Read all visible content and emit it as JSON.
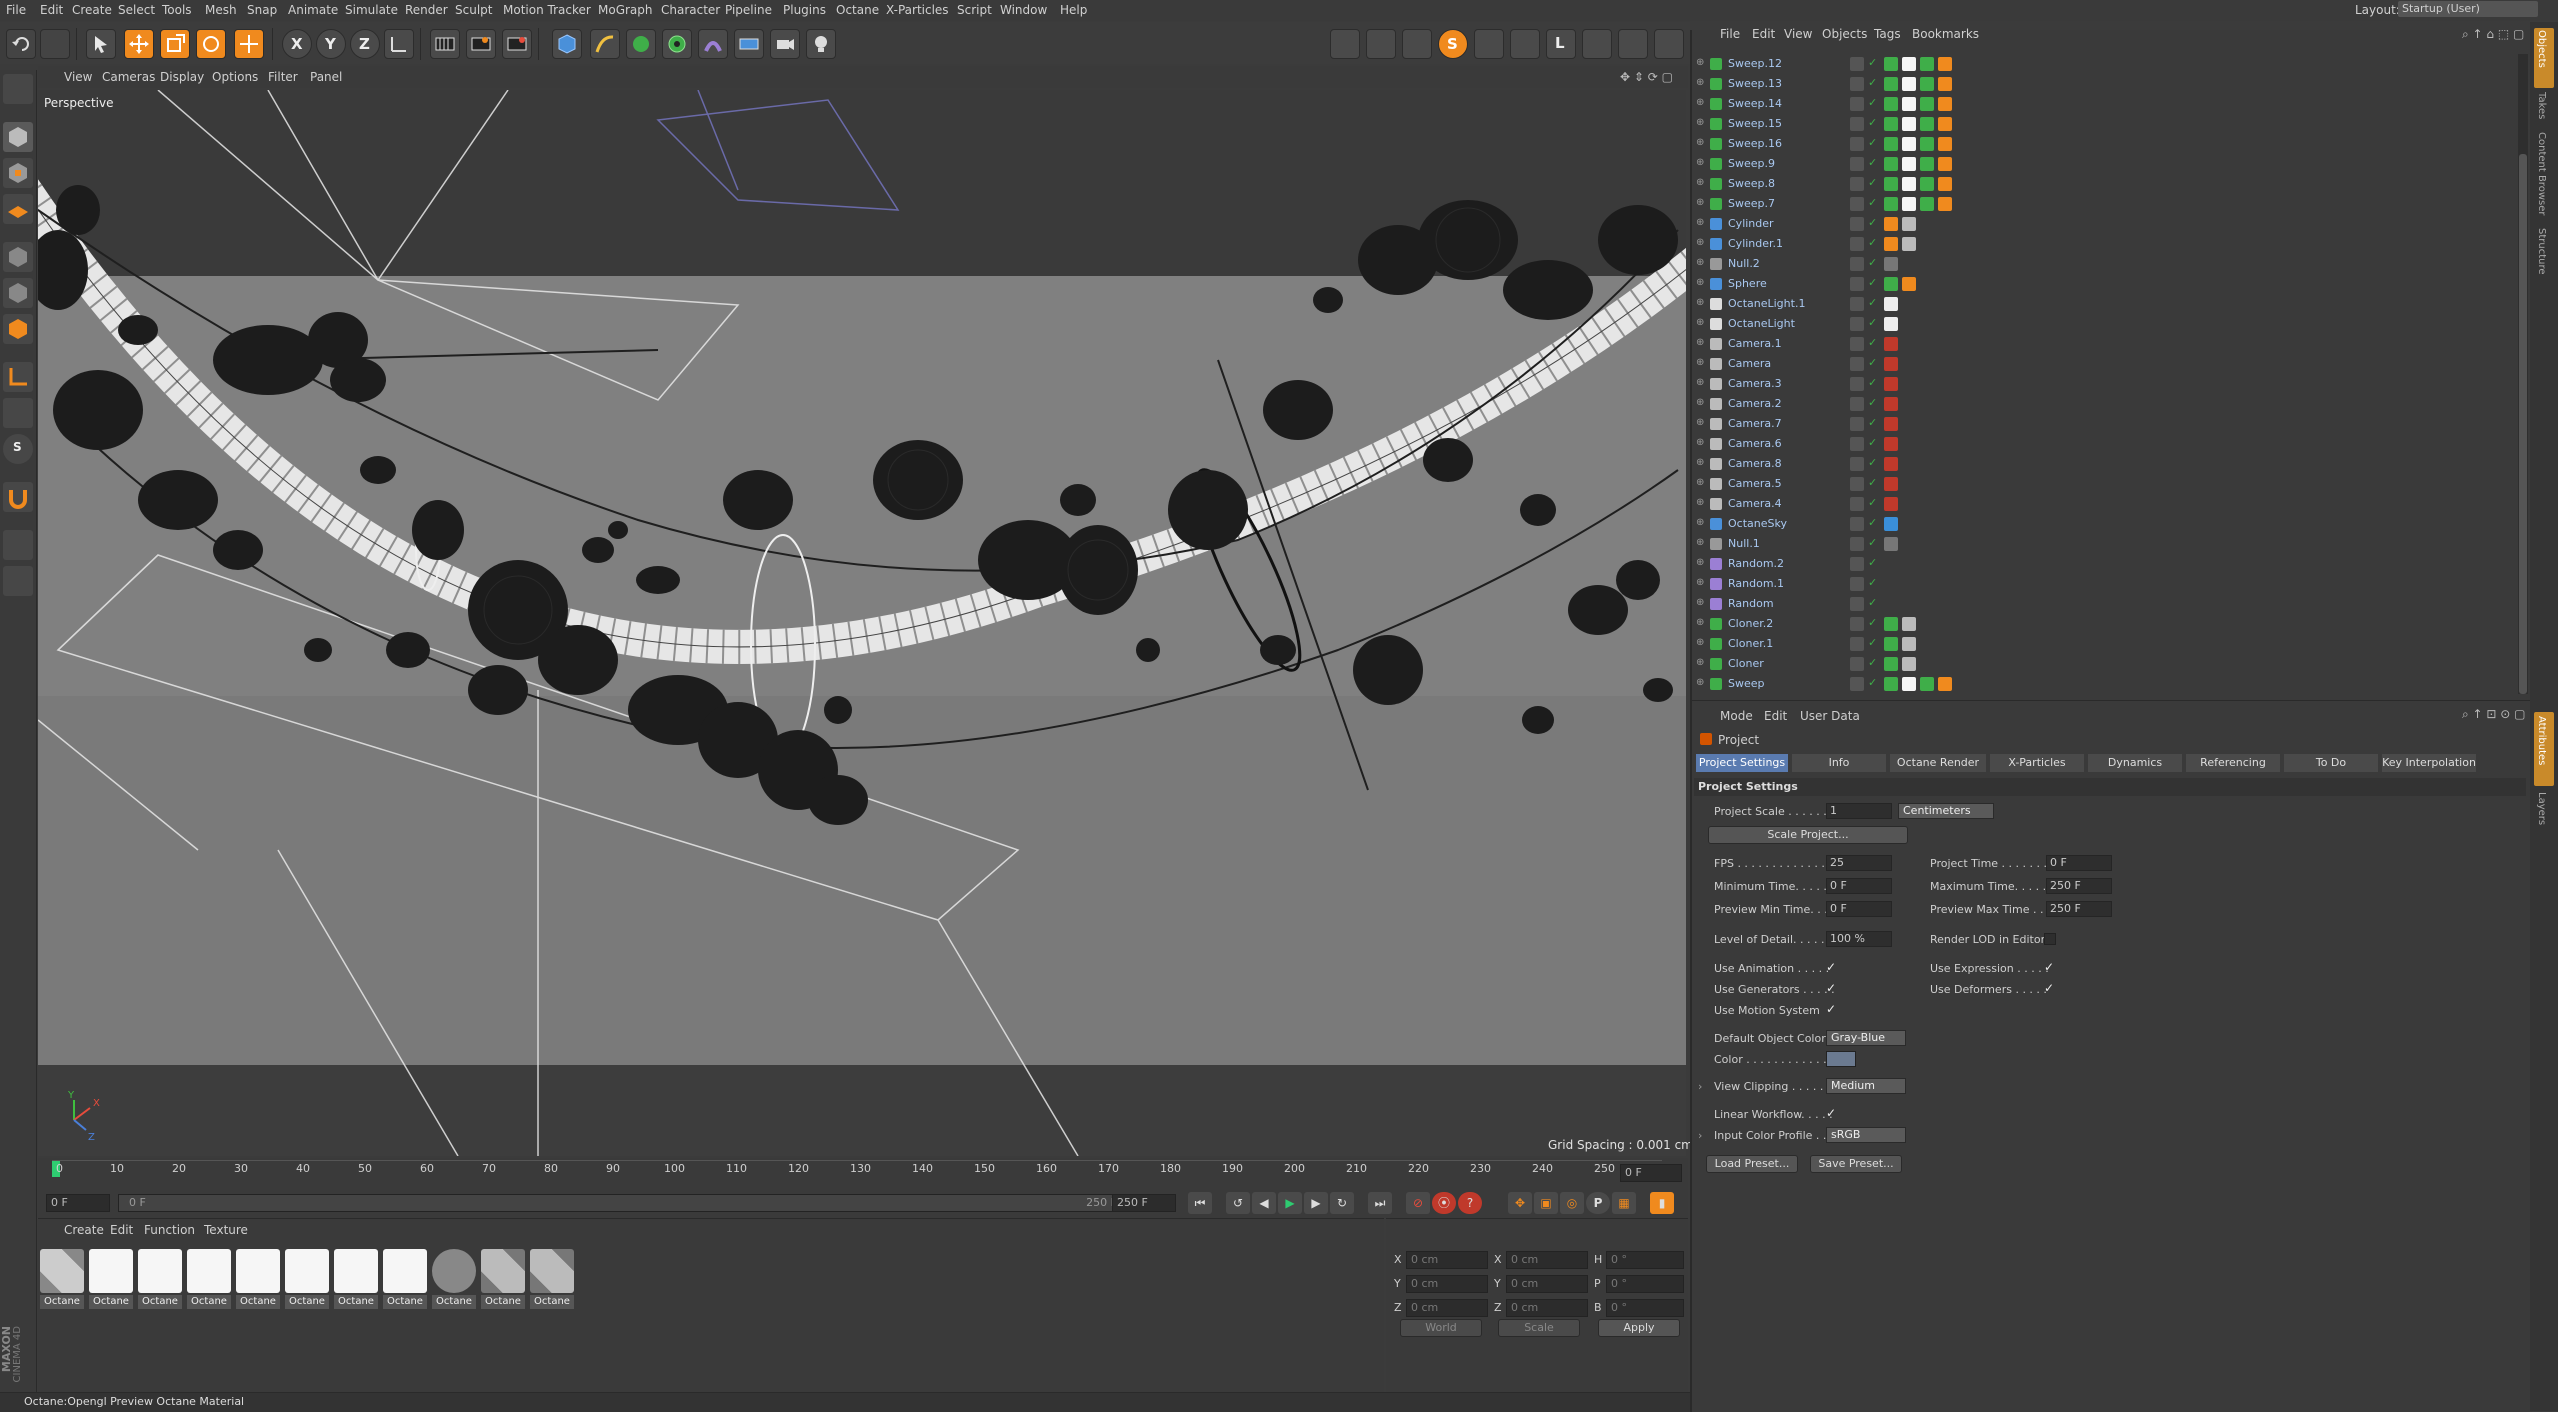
{
  "menu": [
    "File",
    "Edit",
    "Create",
    "Select",
    "Tools",
    "Mesh",
    "Snap",
    "Animate",
    "Simulate",
    "Render",
    "Sculpt",
    "Motion Tracker",
    "MoGraph",
    "Character",
    "Pipeline",
    "Plugins",
    "Octane",
    "X-Particles",
    "Script",
    "Window",
    "Help"
  ],
  "layout": {
    "label": "Layout:",
    "value": "Startup (User)"
  },
  "toolbar": {
    "x_label": "X",
    "y_label": "Y",
    "z_label": "Z",
    "s_label": "S",
    "l_label": "L"
  },
  "viewport_menu": [
    "View",
    "Cameras",
    "Display",
    "Options",
    "Filter",
    "Panel"
  ],
  "viewport": {
    "label": "Perspective",
    "grid_spacing": "Grid Spacing : 0.001 cm",
    "axis_x": "X",
    "axis_y": "Y",
    "axis_z": "Z"
  },
  "timeline": {
    "ticks": [
      "0",
      "10",
      "20",
      "30",
      "40",
      "50",
      "60",
      "70",
      "80",
      "90",
      "100",
      "110",
      "120",
      "130",
      "140",
      "150",
      "160",
      "170",
      "180",
      "190",
      "200",
      "210",
      "220",
      "230",
      "240",
      "250"
    ],
    "current_frame": "0 F",
    "start": "0 F",
    "slider_start": "0 F",
    "slider_end": "250 F",
    "end": "250 F",
    "key_p": "P"
  },
  "material_menu": [
    "Create",
    "Edit",
    "Function",
    "Texture"
  ],
  "materials": [
    "Octane",
    "Octane",
    "Octane",
    "Octane",
    "Octane",
    "Octane",
    "Octane",
    "Octane",
    "Octane",
    "Octane",
    "Octane"
  ],
  "coords": {
    "rows": [
      {
        "a": "X",
        "av": "0 cm",
        "b": "X",
        "bv": "0 cm",
        "c": "H",
        "cv": "0 °"
      },
      {
        "a": "Y",
        "av": "0 cm",
        "b": "Y",
        "bv": "0 cm",
        "c": "P",
        "cv": "0 °"
      },
      {
        "a": "Z",
        "av": "0 cm",
        "b": "Z",
        "bv": "0 cm",
        "c": "B",
        "cv": "0 °"
      }
    ],
    "world": "World",
    "scale": "Scale",
    "apply": "Apply"
  },
  "status": "Octane:Opengl Preview Octane Material",
  "brand": {
    "maxon": "MAXON",
    "cinema": "CINEMA 4D"
  },
  "object_menu": [
    "File",
    "Edit",
    "View",
    "Objects",
    "Tags",
    "Bookmarks"
  ],
  "objects": [
    {
      "name": "Sweep.12",
      "icon": "sweep"
    },
    {
      "name": "Sweep.13",
      "icon": "sweep"
    },
    {
      "name": "Sweep.14",
      "icon": "sweep"
    },
    {
      "name": "Sweep.15",
      "icon": "sweep"
    },
    {
      "name": "Sweep.16",
      "icon": "sweep"
    },
    {
      "name": "Sweep.9",
      "icon": "sweep"
    },
    {
      "name": "Sweep.8",
      "icon": "sweep"
    },
    {
      "name": "Sweep.7",
      "icon": "sweep"
    },
    {
      "name": "Cylinder",
      "icon": "cylinder"
    },
    {
      "name": "Cylinder.1",
      "icon": "cylinder"
    },
    {
      "name": "Null.2",
      "icon": "null"
    },
    {
      "name": "Sphere",
      "icon": "sphere"
    },
    {
      "name": "OctaneLight.1",
      "icon": "light"
    },
    {
      "name": "OctaneLight",
      "icon": "light"
    },
    {
      "name": "Camera.1",
      "icon": "camera"
    },
    {
      "name": "Camera",
      "icon": "camera"
    },
    {
      "name": "Camera.3",
      "icon": "camera"
    },
    {
      "name": "Camera.2",
      "icon": "camera"
    },
    {
      "name": "Camera.7",
      "icon": "camera"
    },
    {
      "name": "Camera.6",
      "icon": "camera"
    },
    {
      "name": "Camera.8",
      "icon": "camera"
    },
    {
      "name": "Camera.5",
      "icon": "camera"
    },
    {
      "name": "Camera.4",
      "icon": "camera"
    },
    {
      "name": "OctaneSky",
      "icon": "sky"
    },
    {
      "name": "Null.1",
      "icon": "null"
    },
    {
      "name": "Random.2",
      "icon": "random"
    },
    {
      "name": "Random.1",
      "icon": "random"
    },
    {
      "name": "Random",
      "icon": "random"
    },
    {
      "name": "Cloner.2",
      "icon": "cloner"
    },
    {
      "name": "Cloner.1",
      "icon": "cloner"
    },
    {
      "name": "Cloner",
      "icon": "cloner"
    },
    {
      "name": "Sweep",
      "icon": "sweep"
    }
  ],
  "attr_menu": [
    "Mode",
    "Edit",
    "User Data"
  ],
  "attr_title": "Project",
  "attr_tabs": [
    "Project Settings",
    "Info",
    "Octane Render",
    "X-Particles",
    "Dynamics",
    "Referencing",
    "To Do",
    "Key Interpolation"
  ],
  "section_title": "Project Settings",
  "props": {
    "project_scale_label": "Project Scale . . . . . .",
    "project_scale": "1",
    "project_scale_unit": "Centimeters",
    "scale_project": "Scale Project...",
    "fps_label": "FPS . . . . . . . . . . . . . .",
    "fps": "25",
    "project_time_label": "Project Time . . . . . . .",
    "project_time": "0 F",
    "min_time_label": "Minimum Time. . . . . .",
    "min_time": "0 F",
    "max_time_label": "Maximum Time. . . . .",
    "max_time": "250 F",
    "prev_min_label": "Preview Min Time. . .",
    "prev_min": "0 F",
    "prev_max_label": "Preview Max Time . .",
    "prev_max": "250 F",
    "lod_label": "Level of Detail. . . . . .",
    "lod": "100 %",
    "render_lod_label": "Render LOD in Editor",
    "use_anim_label": "Use Animation . . . . .",
    "use_expr_label": "Use Expression . . . . .",
    "use_gen_label": "Use Generators . . . . .",
    "use_def_label": "Use Deformers . . . . .",
    "use_motion_label": "Use Motion System",
    "default_color_label": "Default Object Color",
    "default_color": "Gray-Blue",
    "color_label": "Color . . . . . . . . . . . .",
    "view_clip_label": "View Clipping . . . . . .",
    "view_clip": "Medium",
    "linear_label": "Linear Workflow. . . . .",
    "input_profile_label": "Input Color Profile . .",
    "input_profile": "sRGB",
    "load_preset": "Load Preset...",
    "save_preset": "Save Preset...",
    "check": "✓"
  },
  "right_tabs": [
    "Objects",
    "Takes",
    "Content Browser",
    "Structure",
    "Attributes",
    "Layers"
  ],
  "colors": {
    "accent": "#5a7bb0",
    "object_name": "#a9c8f0",
    "viewport_bg": "#5d5d5d",
    "panel": "#3a3a3a"
  }
}
